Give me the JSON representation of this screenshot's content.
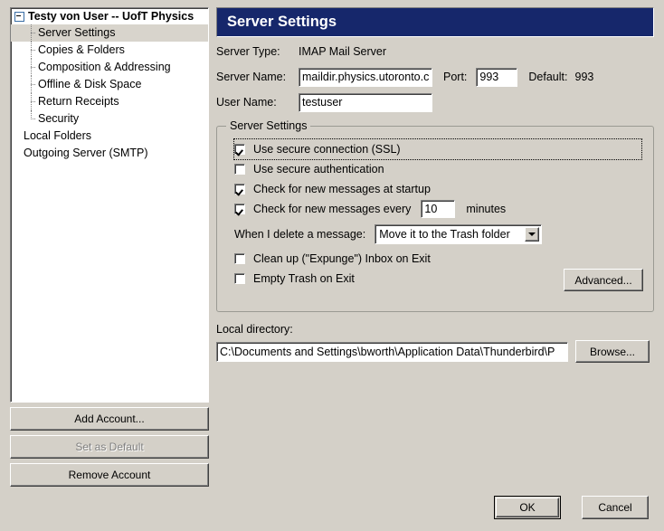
{
  "sidebar": {
    "root_label": "Testy von User -- UofT Physics",
    "children": [
      {
        "label": "Server Settings",
        "selected": true
      },
      {
        "label": "Copies & Folders",
        "selected": false
      },
      {
        "label": "Composition & Addressing",
        "selected": false
      },
      {
        "label": "Offline & Disk Space",
        "selected": false
      },
      {
        "label": "Return Receipts",
        "selected": false
      },
      {
        "label": "Security",
        "selected": false
      }
    ],
    "top_level": [
      {
        "label": "Local Folders"
      },
      {
        "label": "Outgoing Server (SMTP)"
      }
    ],
    "buttons": {
      "add_account": "Add Account...",
      "set_as_default": "Set as Default",
      "remove_account": "Remove Account"
    }
  },
  "panel": {
    "title": "Server Settings",
    "server_type_label": "Server Type:",
    "server_type_value": "IMAP Mail Server",
    "server_name_label": "Server Name:",
    "server_name_value": "maildir.physics.utoronto.c",
    "port_label": "Port:",
    "port_value": "993",
    "default_label": "Default:",
    "default_value": "993",
    "user_name_label": "User Name:",
    "user_name_value": "testuser"
  },
  "group": {
    "legend": "Server Settings",
    "checkboxes": [
      {
        "label": "Use secure connection (SSL)",
        "checked": true,
        "focused": true
      },
      {
        "label": "Use secure authentication",
        "checked": false,
        "focused": false
      },
      {
        "label": "Check for new messages at startup",
        "checked": true,
        "focused": false
      }
    ],
    "interval": {
      "label": "Check for new messages every",
      "checked": true,
      "value": "10",
      "unit": "minutes"
    },
    "delete_row": {
      "label": "When I delete a message:",
      "selected_option": "Move it to the Trash folder"
    },
    "exit_checkboxes": [
      {
        "label": "Clean up (\"Expunge\") Inbox on Exit",
        "checked": false
      },
      {
        "label": "Empty Trash on Exit",
        "checked": false
      }
    ],
    "advanced_button": "Advanced..."
  },
  "local_directory": {
    "label": "Local directory:",
    "value": "C:\\Documents and Settings\\bworth\\Application Data\\Thunderbird\\P",
    "browse_button": "Browse..."
  },
  "dialog_buttons": {
    "ok": "OK",
    "cancel": "Cancel"
  },
  "colors": {
    "header_bg": "#16276b",
    "window_bg": "#d4d0c8",
    "selection_bg": "#d8d4cc",
    "field_bg": "#ffffff",
    "disabled_text": "#808080"
  }
}
